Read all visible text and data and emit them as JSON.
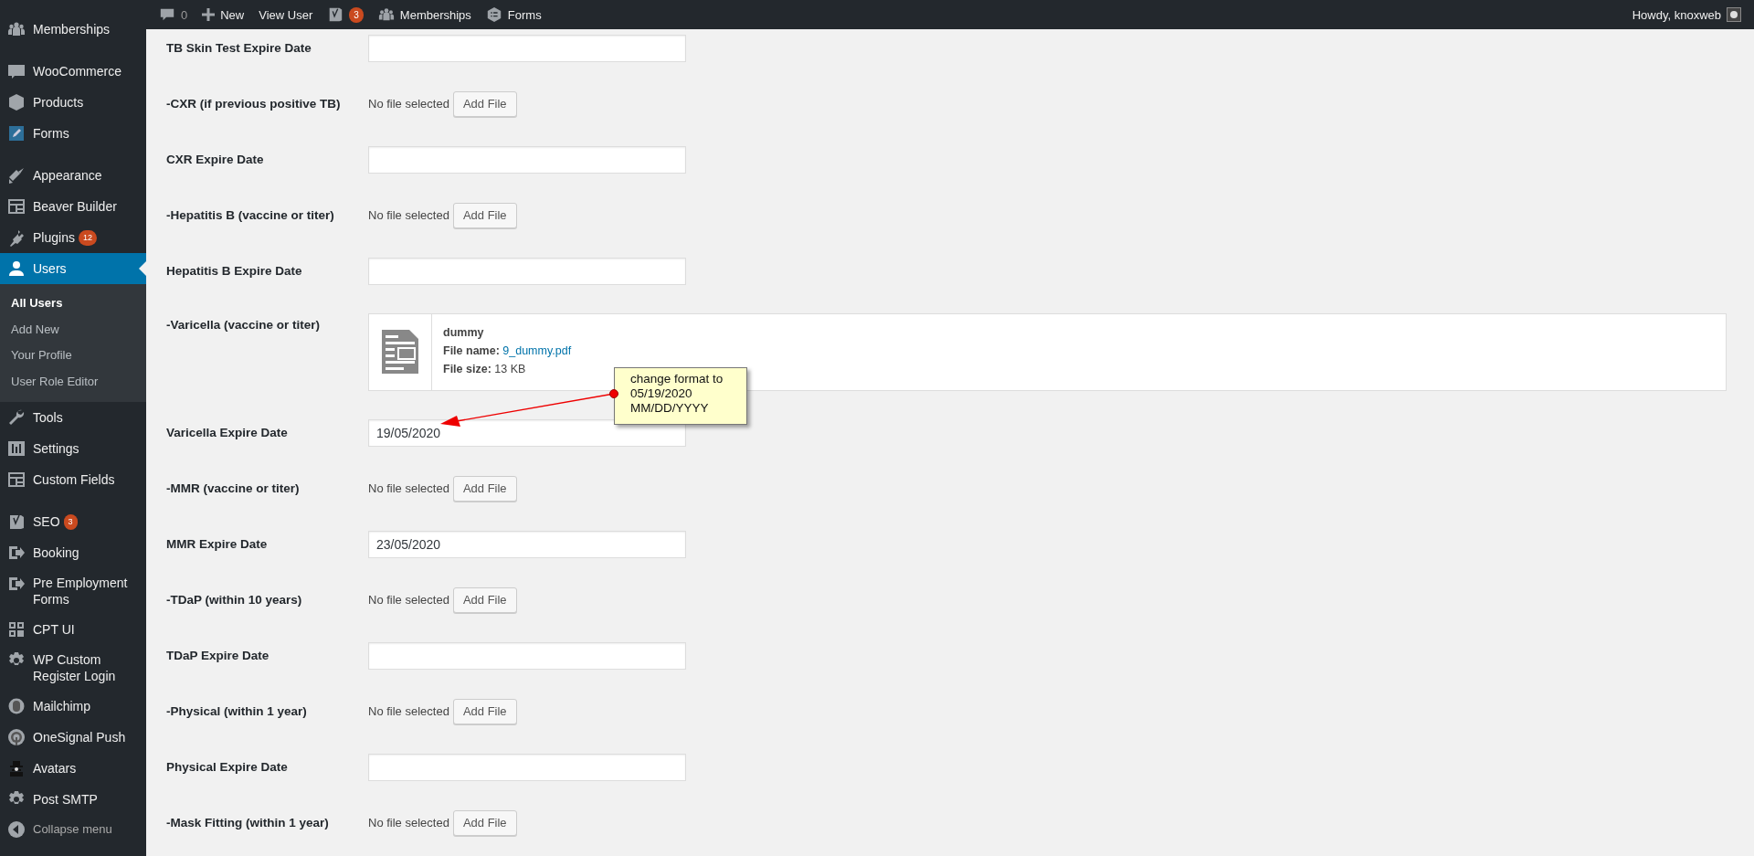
{
  "admin_bar": {
    "comments_count": "0",
    "new_label": "New",
    "view_user": "View User",
    "seo_badge": "3",
    "memberships": "Memberships",
    "forms": "Forms",
    "greeting": "Howdy, knoxweb"
  },
  "sidebar": {
    "groups": [
      {
        "items": [
          {
            "label": "Memberships",
            "selected": false
          }
        ]
      },
      {
        "items": [
          {
            "label": "WooCommerce",
            "selected": false
          },
          {
            "label": "Products",
            "selected": false
          },
          {
            "label": "Forms",
            "selected": false
          }
        ]
      },
      {
        "items": [
          {
            "label": "Appearance",
            "selected": false
          },
          {
            "label": "Beaver Builder",
            "selected": false
          },
          {
            "label": "Plugins",
            "selected": false,
            "badge": "12"
          },
          {
            "label": "Users",
            "selected": true,
            "submenu": [
              {
                "label": "All Users",
                "selected": true
              },
              {
                "label": "Add New",
                "selected": false
              },
              {
                "label": "Your Profile",
                "selected": false
              },
              {
                "label": "User Role Editor",
                "selected": false
              }
            ]
          },
          {
            "label": "Tools",
            "selected": false
          },
          {
            "label": "Settings",
            "selected": false
          },
          {
            "label": "Custom Fields",
            "selected": false
          }
        ]
      },
      {
        "items": [
          {
            "label": "SEO",
            "selected": false,
            "badge": "3"
          },
          {
            "label": "Booking",
            "selected": false
          },
          {
            "label": "Pre Employment Forms",
            "selected": false
          },
          {
            "label": "CPT UI",
            "selected": false
          },
          {
            "label": "WP Custom Register Login",
            "selected": false
          },
          {
            "label": "Mailchimp",
            "selected": false
          },
          {
            "label": "OneSignal Push",
            "selected": false
          },
          {
            "label": "Avatars",
            "selected": false
          },
          {
            "label": "Post SMTP",
            "selected": false
          }
        ]
      }
    ],
    "collapse": "Collapse menu"
  },
  "fields": [
    {
      "kind": "date",
      "label": "TB Skin Test Expire Date"
    },
    {
      "kind": "file",
      "label": "-CXR (if previous positive TB)",
      "status": "No file selected",
      "button": "Add File"
    },
    {
      "kind": "date",
      "label": "CXR Expire Date"
    },
    {
      "kind": "file",
      "label": "-Hepatitis B (vaccine or titer)",
      "status": "No file selected",
      "button": "Add File"
    },
    {
      "kind": "date",
      "label": "Hepatitis B Expire Date"
    },
    {
      "kind": "attachment",
      "label": "-Varicella (vaccine or titer)",
      "title": "dummy",
      "name_label": "File name:",
      "file_name": "9_dummy.pdf",
      "size_label": "File size:",
      "size": "13 KB"
    },
    {
      "kind": "date",
      "label": "Varicella Expire Date",
      "value": "19/05/2020"
    },
    {
      "kind": "file",
      "label": "-MMR (vaccine or titer)",
      "status": "No file selected",
      "button": "Add File"
    },
    {
      "kind": "date",
      "label": "MMR Expire Date",
      "value": "23/05/2020"
    },
    {
      "kind": "file",
      "label": "-TDaP (within 10 years)",
      "status": "No file selected",
      "button": "Add File"
    },
    {
      "kind": "date",
      "label": "TDaP Expire Date"
    },
    {
      "kind": "file",
      "label": "-Physical (within 1 year)",
      "status": "No file selected",
      "button": "Add File"
    },
    {
      "kind": "date",
      "label": "Physical Expire Date"
    },
    {
      "kind": "file",
      "label": "-Mask Fitting (within 1 year)",
      "status": "No file selected",
      "button": "Add File"
    }
  ],
  "annotation": {
    "text": "change format to\n05/19/2020\nMM/DD/YYYY"
  }
}
